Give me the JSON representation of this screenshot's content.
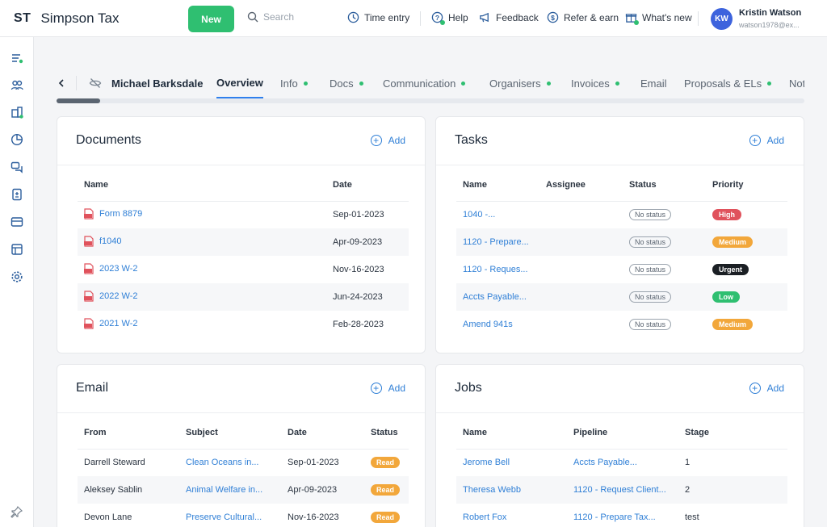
{
  "app": {
    "brand_mark": "ST",
    "brand_name": "Simpson Tax"
  },
  "topbar": {
    "new_label": "New",
    "search_placeholder": "Search",
    "time_entry": "Time entry",
    "help": "Help",
    "feedback": "Feedback",
    "refer": "Refer & earn",
    "whats_new": "What's new"
  },
  "user": {
    "initials": "KW",
    "name": "Kristin Watson",
    "email": "watson1978@ex..."
  },
  "client_name": "Michael Barksdale",
  "tabs": [
    {
      "label": "Overview",
      "dot": false,
      "active": true
    },
    {
      "label": "Info",
      "dot": true
    },
    {
      "label": "Docs",
      "dot": true
    },
    {
      "label": "Communication",
      "dot": true
    },
    {
      "label": "Organisers",
      "dot": true
    },
    {
      "label": "Invoices",
      "dot": true
    },
    {
      "label": "Email",
      "dot": false
    },
    {
      "label": "Proposals & ELs",
      "dot": true
    },
    {
      "label": "Not",
      "dot": false
    }
  ],
  "add_label": "Add",
  "documents": {
    "title": "Documents",
    "columns": [
      "Name",
      "Date"
    ],
    "rows": [
      {
        "name": "Form 8879",
        "date": "Sep-01-2023"
      },
      {
        "name": "f1040",
        "date": "Apr-09-2023"
      },
      {
        "name": "2023 W-2",
        "date": "Nov-16-2023"
      },
      {
        "name": "2022 W-2",
        "date": "Jun-24-2023"
      },
      {
        "name": "2021 W-2",
        "date": "Feb-28-2023"
      }
    ]
  },
  "tasks": {
    "title": "Tasks",
    "columns": [
      "Name",
      "Assignee",
      "Status",
      "Priority"
    ],
    "rows": [
      {
        "name": "1040 -...",
        "assignee": "",
        "status": "No status",
        "priority": "High"
      },
      {
        "name": "1120 - Prepare...",
        "assignee": "",
        "status": "No status",
        "priority": "Medium"
      },
      {
        "name": "1120 - Reques...",
        "assignee": "",
        "status": "No status",
        "priority": "Urgent"
      },
      {
        "name": "Accts Payable...",
        "assignee": "",
        "status": "No status",
        "priority": "Low"
      },
      {
        "name": "Amend 941s",
        "assignee": "",
        "status": "No status",
        "priority": "Medium"
      }
    ],
    "priority_colors": {
      "High": "#e0525c",
      "Medium": "#f2a73b",
      "Urgent": "#1b1f24",
      "Low": "#2fbf71"
    }
  },
  "email": {
    "title": "Email",
    "columns": [
      "From",
      "Subject",
      "Date",
      "Status"
    ],
    "rows": [
      {
        "from": "Darrell Steward",
        "subject": "Clean Oceans in...",
        "date": "Sep-01-2023",
        "status": "Read"
      },
      {
        "from": "Aleksey Sablin",
        "subject": "Animal Welfare in...",
        "date": "Apr-09-2023",
        "status": "Read"
      },
      {
        "from": "Devon Lane",
        "subject": "Preserve Cultural...",
        "date": "Nov-16-2023",
        "status": "Read"
      }
    ]
  },
  "jobs": {
    "title": "Jobs",
    "columns": [
      "Name",
      "Pipeline",
      "Stage"
    ],
    "rows": [
      {
        "name": "Jerome Bell",
        "pipeline": "Accts Payable...",
        "stage": "1"
      },
      {
        "name": "Theresa Webb",
        "pipeline": "1120 - Request Client...",
        "stage": "2"
      },
      {
        "name": "Robert Fox",
        "pipeline": "1120 - Prepare Tax...",
        "stage": "test"
      }
    ]
  },
  "colors": {
    "accent": "#2f80ed",
    "green": "#2fbf71",
    "link": "#2f7fd6"
  }
}
